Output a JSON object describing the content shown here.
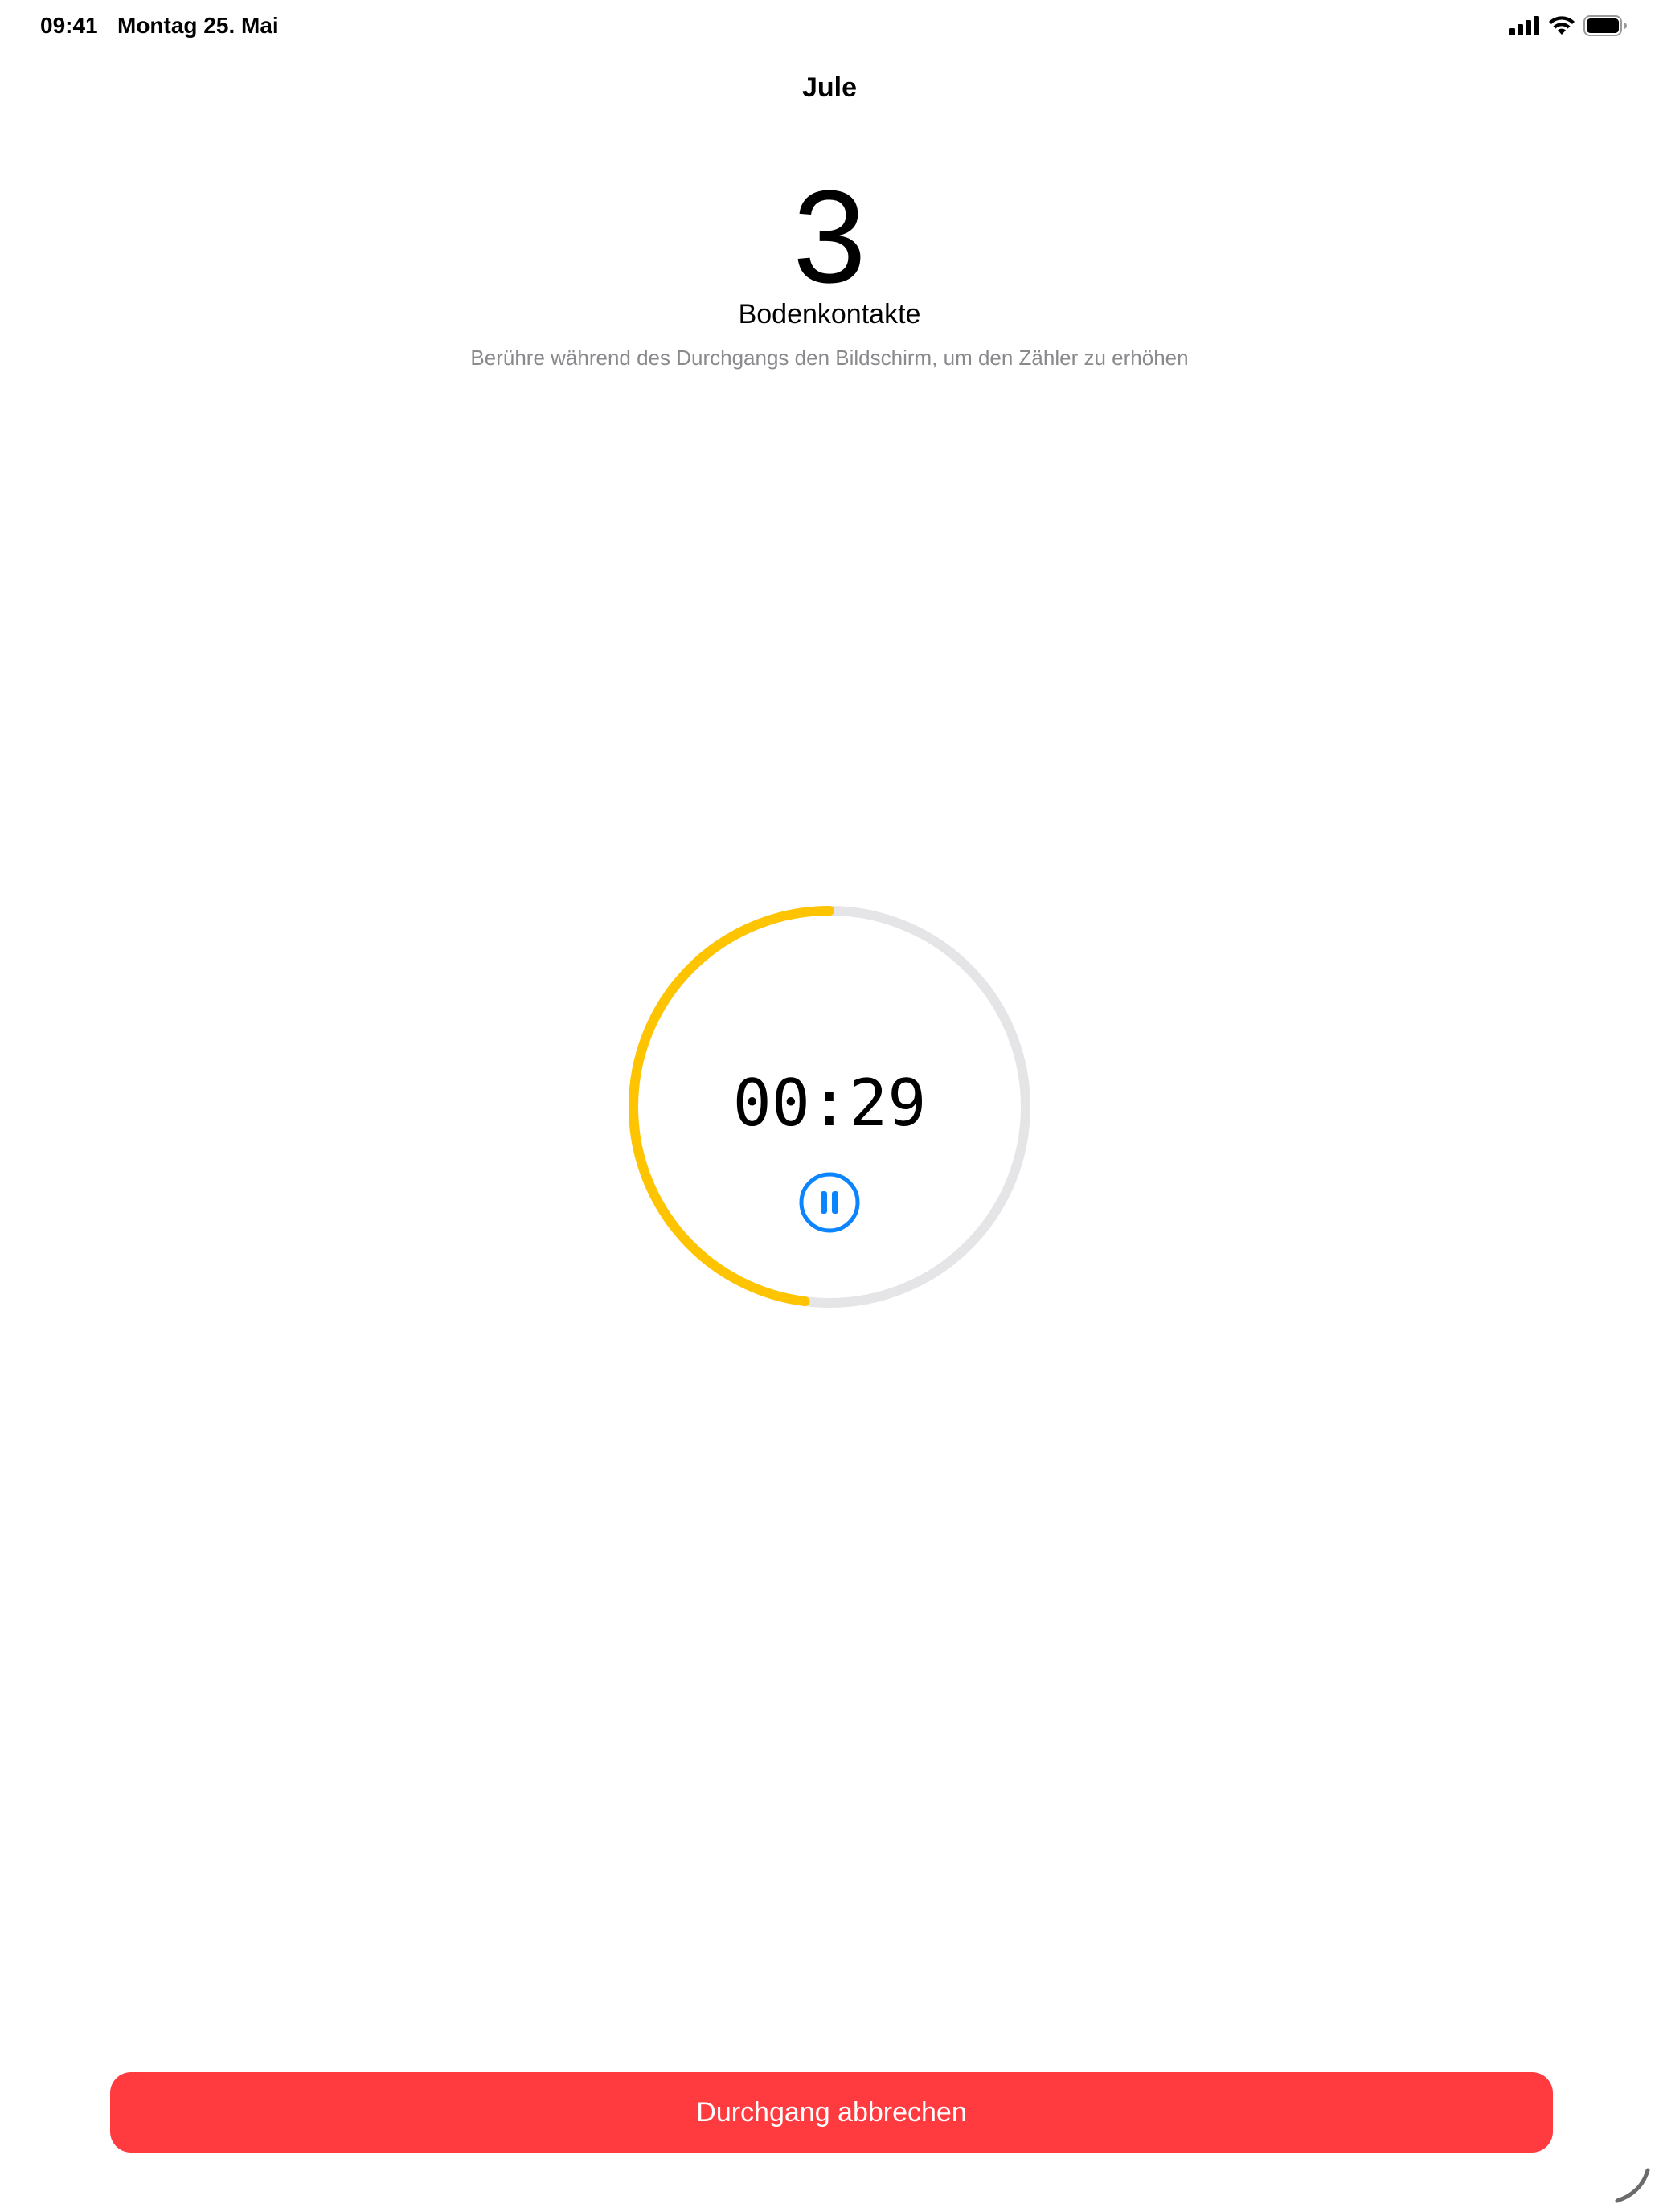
{
  "status_bar": {
    "time": "09:41",
    "date": "Montag 25. Mai",
    "icons": [
      "cellular-signal-icon",
      "wifi-icon",
      "battery-icon"
    ]
  },
  "header": {
    "title": "Jule"
  },
  "counter": {
    "value": "3",
    "label": "Bodenkontakte",
    "hint": "Berühre während des Durchgangs den Bildschirm, um den Zähler zu erhöhen"
  },
  "timer": {
    "time": "00:29",
    "progress": 0.48,
    "accent_color": "#ffc400",
    "track_color": "#e5e5e7",
    "pause_icon": "pause-circle-icon",
    "pause_color": "#0a84ff"
  },
  "actions": {
    "cancel_label": "Durchgang abbrechen",
    "cancel_color": "#ff3b40"
  }
}
